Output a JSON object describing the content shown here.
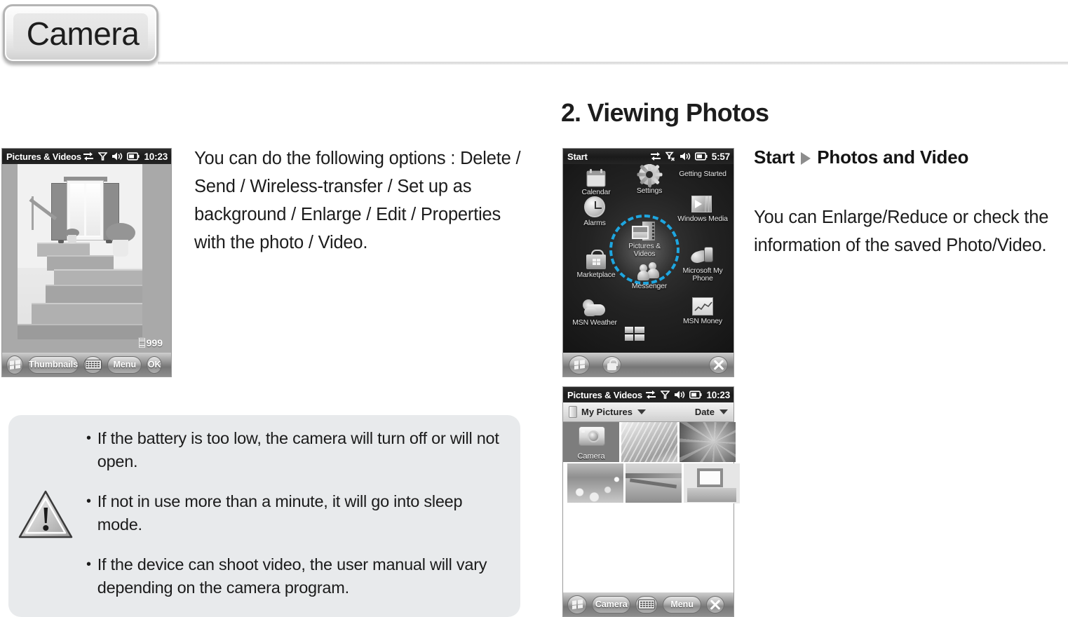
{
  "header": {
    "tab_title": "Camera"
  },
  "left_column": {
    "paragraph": "You can do the following options : Delete / Send / Wireless-transfer / Set up as background / Enlarge / Edit / Properties with the photo / Video."
  },
  "section": {
    "number": "2.",
    "title": "Viewing Photos"
  },
  "right_column": {
    "path_start": "Start",
    "path_target": "Photos and Video",
    "paragraph": "You can Enlarge/Reduce or check the information of the saved Photo/Video."
  },
  "note": {
    "bullet": "•",
    "items": [
      "If the battery is too low, the camera will turn off or will not open.",
      "If not in use more than a minute, it will go into sleep mode.",
      "If the device can shoot video, the user manual will vary depending on the camera program."
    ]
  },
  "viewer_device": {
    "statusbar": {
      "title": "Pictures & Videos",
      "time": "10:23",
      "icons": [
        "sync-icon",
        "signal-icon",
        "speaker-icon",
        "battery-icon"
      ]
    },
    "photo_counter": "999",
    "softkeys": [
      "start-flag",
      "Thumbnails",
      "keyboard",
      "Menu",
      "OK"
    ],
    "softkey_labels": {
      "thumbnails": "Thumbnails",
      "menu": "Menu",
      "ok": "OK"
    }
  },
  "start_device": {
    "statusbar": {
      "title": "Start",
      "time": "5:57",
      "icons": [
        "sync-icon",
        "no-signal-icon",
        "speaker-icon",
        "battery-icon"
      ]
    },
    "tiles": [
      {
        "label": "Calendar",
        "icon": "calendar-icon"
      },
      {
        "label": "Settings",
        "icon": "gear-icon"
      },
      {
        "label": "Getting Started",
        "icon": "getting-started-icon"
      },
      {
        "label": "Alarms",
        "icon": "clock-icon"
      },
      {
        "label": "Windows Media",
        "icon": "media-player-icon"
      },
      {
        "label": "Pictures & Videos",
        "icon": "pictures-videos-icon"
      },
      {
        "label": "Marketplace",
        "icon": "shopping-bag-icon"
      },
      {
        "label": "Microsoft My Phone",
        "icon": "my-phone-icon"
      },
      {
        "label": "Messenger",
        "icon": "people-icon"
      },
      {
        "label": "MSN Weather",
        "icon": "weather-cloud-icon"
      },
      {
        "label": "MSN Money",
        "icon": "stock-chart-icon"
      }
    ],
    "highlighted_tile": "Pictures & Videos",
    "highlight_color": "#1ea6e0",
    "softkeys": [
      "start-flag",
      "lock-icon",
      "close-icon"
    ]
  },
  "gallery_device": {
    "statusbar": {
      "title": "Pictures & Videos",
      "time": "10:23",
      "icons": [
        "sync-icon",
        "signal-icon",
        "speaker-icon",
        "battery-icon"
      ]
    },
    "toolbar": {
      "folder_label": "My Pictures",
      "sort_label": "Date"
    },
    "cells": [
      {
        "label": "Camera",
        "kind": "camera-shortcut",
        "selected": true
      },
      {
        "label": "",
        "kind": "grass-thumbnail",
        "selected": false
      },
      {
        "label": "",
        "kind": "leaf-thumbnail",
        "selected": false
      },
      {
        "label": "",
        "kind": "flowers-thumbnail",
        "selected": false
      },
      {
        "label": "",
        "kind": "pier-thumbnail",
        "selected": false
      },
      {
        "label": "",
        "kind": "house-thumbnail",
        "selected": false
      }
    ],
    "softkeys": [
      "start-flag",
      "Camera",
      "keyboard",
      "Menu",
      "close"
    ],
    "softkey_labels": {
      "camera": "Camera",
      "menu": "Menu"
    }
  }
}
